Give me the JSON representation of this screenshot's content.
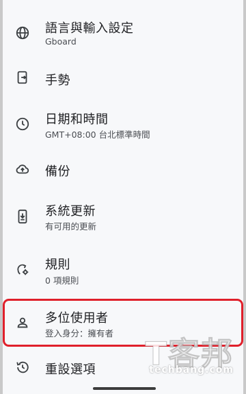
{
  "settings": {
    "items": [
      {
        "icon": "globe-icon",
        "title": "語言與輸入設定",
        "subtitle": "Gboard"
      },
      {
        "icon": "gesture-icon",
        "title": "手勢",
        "subtitle": ""
      },
      {
        "icon": "clock-icon",
        "title": "日期和時間",
        "subtitle": "GMT+08:00 台北標準時間"
      },
      {
        "icon": "cloud-upload-icon",
        "title": "備份",
        "subtitle": ""
      },
      {
        "icon": "system-update-icon",
        "title": "系統更新",
        "subtitle": "有可用的更新"
      },
      {
        "icon": "rules-icon",
        "title": "規則",
        "subtitle": "0 項規則"
      },
      {
        "icon": "person-icon",
        "title": "多位使用者",
        "subtitle": "登入身分：擁有者"
      },
      {
        "icon": "history-icon",
        "title": "重設選項",
        "subtitle": ""
      }
    ]
  },
  "highlight_color": "#e0202b",
  "watermark": {
    "logo_text": "T客邦",
    "site": "techbang.com"
  }
}
